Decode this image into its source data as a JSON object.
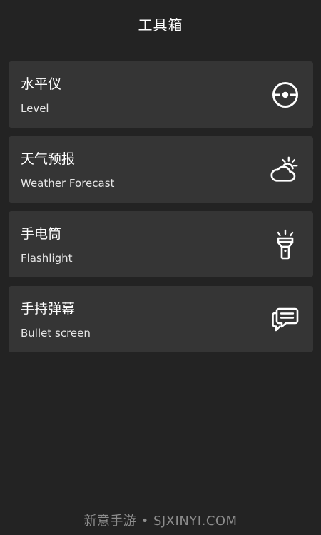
{
  "header": {
    "title": "工具箱"
  },
  "tools": [
    {
      "name": "水平仪",
      "subtitle": "Level",
      "icon": "level-target-icon"
    },
    {
      "name": "天气预报",
      "subtitle": "Weather Forecast",
      "icon": "weather-cloud-sun-icon"
    },
    {
      "name": "手电筒",
      "subtitle": "Flashlight",
      "icon": "flashlight-icon"
    },
    {
      "name": "手持弹幕",
      "subtitle": "Bullet screen",
      "icon": "chat-bubbles-icon"
    }
  ],
  "watermark": "新意手游 • SJXINYI.COM",
  "colors": {
    "background": "#232323",
    "card": "#353535",
    "text": "#ffffff",
    "watermark": "#8d8d8d"
  }
}
